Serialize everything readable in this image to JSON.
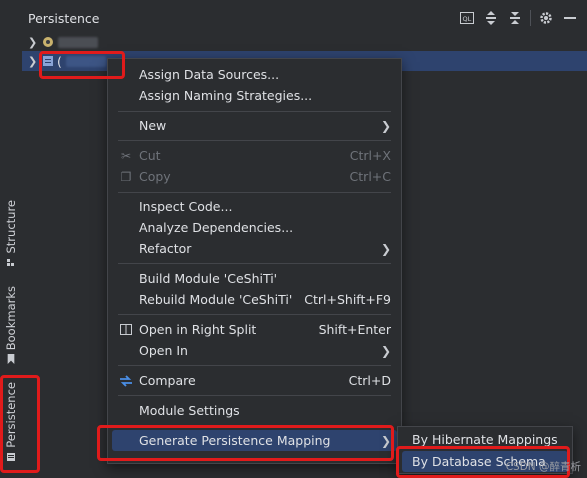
{
  "panel": {
    "title": "Persistence"
  },
  "toolbar": {
    "icons": [
      "ql-console-icon",
      "expand-all-icon",
      "collapse-all-icon",
      "gear-icon",
      "hide-icon"
    ]
  },
  "sidebar": {
    "tabs": [
      {
        "label": "Structure",
        "icon": "structure-icon"
      },
      {
        "label": "Bookmarks",
        "icon": "bookmark-icon"
      },
      {
        "label": "Persistence",
        "icon": "persistence-icon"
      }
    ]
  },
  "tree": {
    "row2_text": "("
  },
  "menu": {
    "assign_data_sources": "Assign Data Sources...",
    "assign_naming": "Assign Naming Strategies...",
    "new": "New",
    "cut": "Cut",
    "cut_sc": "Ctrl+X",
    "copy": "Copy",
    "copy_sc": "Ctrl+C",
    "inspect": "Inspect Code...",
    "analyze": "Analyze Dependencies...",
    "refactor": "Refactor",
    "build": "Build Module 'CeShiTi'",
    "rebuild": "Rebuild Module 'CeShiTi'",
    "rebuild_sc": "Ctrl+Shift+F9",
    "open_right": "Open in Right Split",
    "open_right_sc": "Shift+Enter",
    "open_in": "Open In",
    "compare": "Compare",
    "compare_sc": "Ctrl+D",
    "module_settings": "Module Settings",
    "generate": "Generate Persistence Mapping"
  },
  "submenu": {
    "hibernate": "By Hibernate Mappings",
    "database": "By Database Schema"
  },
  "watermark": "CSDN @醉青析"
}
